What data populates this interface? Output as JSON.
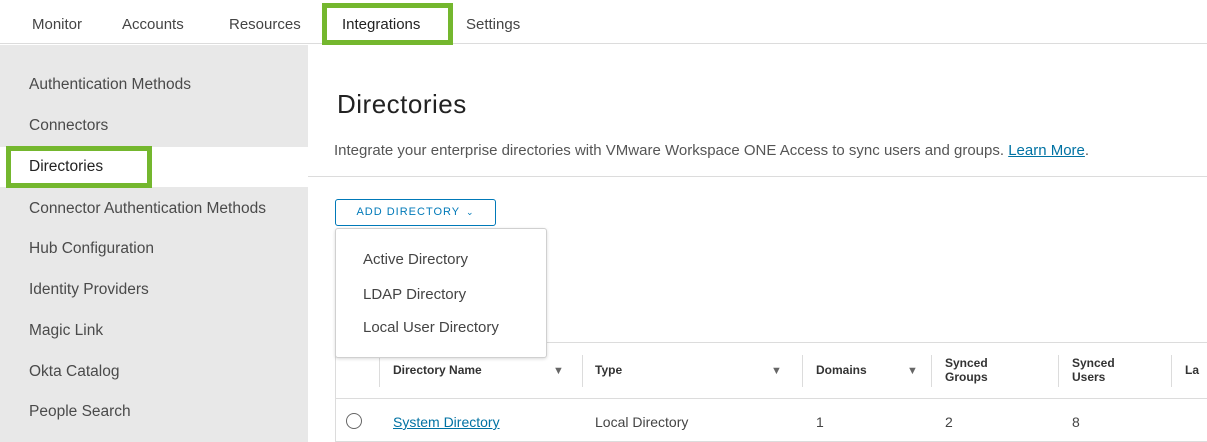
{
  "topnav": {
    "tabs": [
      {
        "label": "Monitor"
      },
      {
        "label": "Accounts"
      },
      {
        "label": "Resources"
      },
      {
        "label": "Integrations"
      },
      {
        "label": "Settings"
      }
    ],
    "active_tab": "Integrations"
  },
  "sidebar": {
    "items": [
      {
        "label": "Authentication Methods"
      },
      {
        "label": "Connectors"
      },
      {
        "label": "Directories"
      },
      {
        "label": "Connector Authentication Methods"
      },
      {
        "label": "Hub Configuration"
      },
      {
        "label": "Identity Providers"
      },
      {
        "label": "Magic Link"
      },
      {
        "label": "Okta Catalog"
      },
      {
        "label": "People Search"
      }
    ],
    "selected": "Directories"
  },
  "main": {
    "title": "Directories",
    "subtitle": "Integrate your enterprise directories with VMware Workspace ONE Access to sync users and groups.",
    "learn_more": "Learn More",
    "add_button": "ADD DIRECTORY",
    "dropdown": [
      "Active Directory",
      "LDAP Directory",
      "Local User Directory"
    ]
  },
  "table": {
    "columns": [
      "Directory Name",
      "Type",
      "Domains",
      "Synced Groups",
      "Synced Users",
      "La"
    ],
    "rows": [
      {
        "name": "System Directory",
        "type": "Local Directory",
        "domains": "1",
        "groups": "2",
        "users": "8"
      }
    ]
  },
  "colors": {
    "highlight": "#74b72e",
    "accent": "#0079b8",
    "link": "#0072a3",
    "sidebar_bg": "#e8e8e8"
  },
  "icons": {
    "filter": "filter-icon",
    "chevron": "chevron-down-icon",
    "radio": "radio-button"
  }
}
